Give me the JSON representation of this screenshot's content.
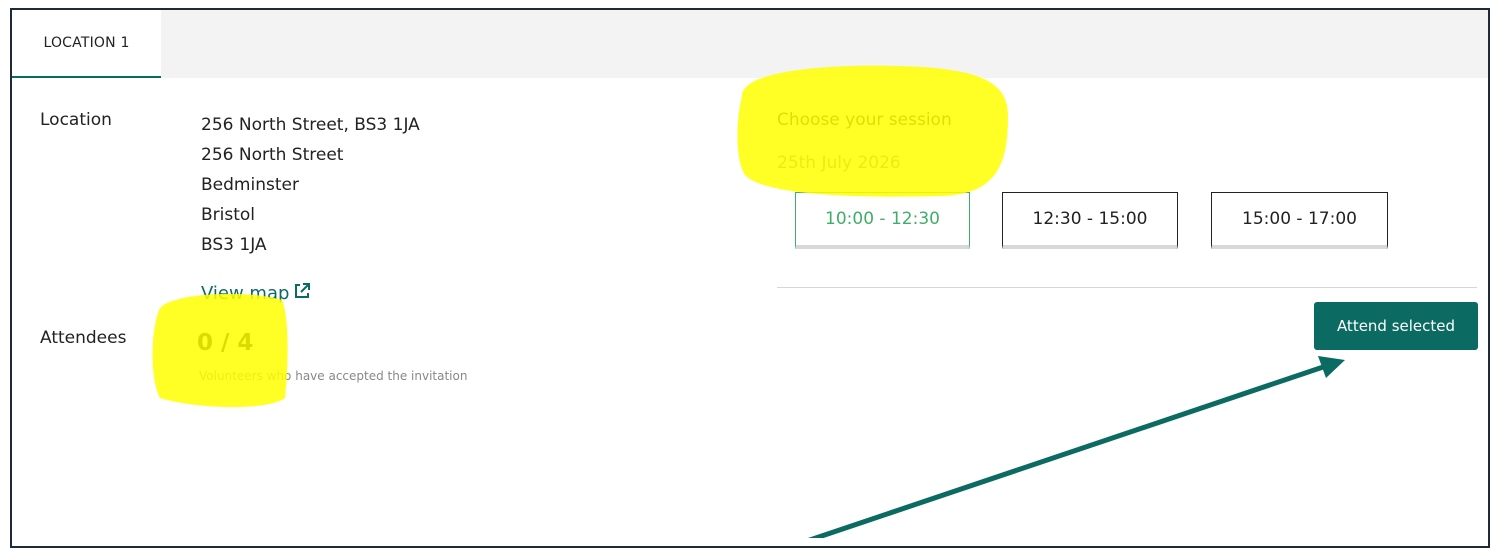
{
  "tabs": [
    {
      "label": "LOCATION 1"
    }
  ],
  "location": {
    "label": "Location",
    "address_lines": [
      "256 North Street, BS3 1JA",
      "256 North Street",
      "Bedminster",
      "Bristol",
      "BS3 1JA"
    ],
    "view_map_label": "View map",
    "view_map_icon": "external-link-icon"
  },
  "attendees": {
    "label": "Attendees",
    "count": "0 / 4",
    "caption": "Volunteers who have accepted the invitation"
  },
  "session": {
    "heading": "Choose your session",
    "date": "25th July 2026",
    "slots": [
      {
        "label": "10:00 - 12:30",
        "selected": true
      },
      {
        "label": "12:30 - 15:00",
        "selected": false
      },
      {
        "label": "15:00 - 17:00",
        "selected": false
      }
    ]
  },
  "actions": {
    "attend_label": "Attend selected"
  },
  "colors": {
    "accent": "#0b6b63",
    "selected_slot": "#3fae6a",
    "highlight": "#ffff00",
    "annotation_arrow": "#0b6b63"
  }
}
